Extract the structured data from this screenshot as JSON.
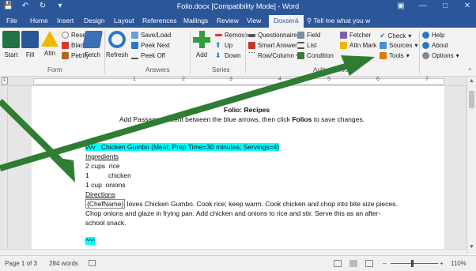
{
  "window": {
    "title": "Folio.docx [Compatibility Mode] - Word"
  },
  "tabs": [
    "File",
    "Home",
    "Insert",
    "Design",
    "Layout",
    "References",
    "Mailings",
    "Review",
    "View",
    "Doxserá"
  ],
  "active_tab": "Doxserá",
  "tell_me": "Tell me what you w",
  "ribbon": {
    "start": "Start",
    "fill": "Fill",
    "attn": "Attn",
    "reset": "Reset",
    "blanks": "Blanks",
    "petrify": "Petrify",
    "fetch": "Fetch",
    "form_group": "Form",
    "refresh": "Refresh",
    "save_load": "Save/Load",
    "peek_next": "Peek Next",
    "peek_off": "Peek Off",
    "answers_group": "Answers",
    "add": "Add",
    "remove": "Remove",
    "up": "Up",
    "down": "Down",
    "series_group": "Series",
    "questionnaire": "Questionnaire",
    "smart_answer": "Smart Answer",
    "row_column": "Row/Column",
    "field": "Field",
    "list": "List",
    "condition": "Condition",
    "fetcher": "Fetcher",
    "attn_mark": "Attn Mark",
    "authors_tools_group": "Author's Tools",
    "check": "Check",
    "sources": "Sources",
    "tools": "Tools",
    "help": "Help",
    "about": "About",
    "options": "Options"
  },
  "ruler_numbers": [
    "1",
    "2",
    "3",
    "4",
    "5",
    "6",
    "7"
  ],
  "document": {
    "title_prefix": "Folio:",
    "title_rest": "Recipes",
    "instruction_a": "Add Passage content between the blue arrows, then click ",
    "instruction_bold": "Folios",
    "instruction_b": " to save changes.",
    "arrow_start": "vvv",
    "recipe_title": "Chicken Gumbo (Meat; Prep Time=30 minutes; Servings=4)",
    "ingredients_heading": "Ingredients",
    "ingredients": [
      {
        "qty": "2 cups",
        "item": "rice"
      },
      {
        "qty": "1",
        "item": "chicken"
      },
      {
        "qty": "1 cup",
        "item": "onions"
      }
    ],
    "directions_heading": "Directions",
    "chef_field": "{ChefName}",
    "directions_line1": " loves Chicken Gumbo.  Cook rice; keep warm. Cook chicken and chop into bite size pieces.",
    "directions_line2": "Chop onions and glaze in frying pan.  Add chicken and onions to rice and stir.  Serve this as an after-",
    "directions_line3": "school snack.",
    "arrow_end": "^^^"
  },
  "status": {
    "page": "Page 1 of 3",
    "words": "284 words",
    "zoom": "110%"
  },
  "colors": {
    "word_blue": "#2b579a",
    "highlight": "#00ffff",
    "arrow_green": "#2e7d32"
  }
}
